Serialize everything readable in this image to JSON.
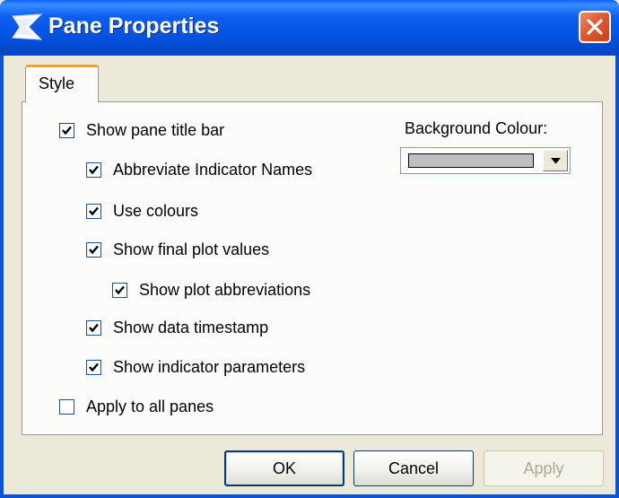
{
  "window": {
    "title": "Pane Properties"
  },
  "tabs": [
    {
      "label": "Style",
      "active": true
    }
  ],
  "options": [
    {
      "label": "Show pane title bar",
      "checked": true
    },
    {
      "label": "Abbreviate Indicator Names",
      "checked": true
    },
    {
      "label": "Use colours",
      "checked": true
    },
    {
      "label": "Show final plot values",
      "checked": true
    },
    {
      "label": "Show plot abbreviations",
      "checked": true
    },
    {
      "label": "Show data timestamp",
      "checked": true
    },
    {
      "label": "Show indicator parameters",
      "checked": true
    },
    {
      "label": "Apply to all panes",
      "checked": false
    }
  ],
  "background": {
    "label": "Background Colour:",
    "color": "#c0c0c0"
  },
  "buttons": {
    "ok": "OK",
    "cancel": "Cancel",
    "apply": "Apply"
  },
  "colors": {
    "titlebar": "#0a52d6",
    "dialog_bg": "#ece9d8",
    "close": "#e05a30",
    "tab_accent": "#e8a33a"
  }
}
